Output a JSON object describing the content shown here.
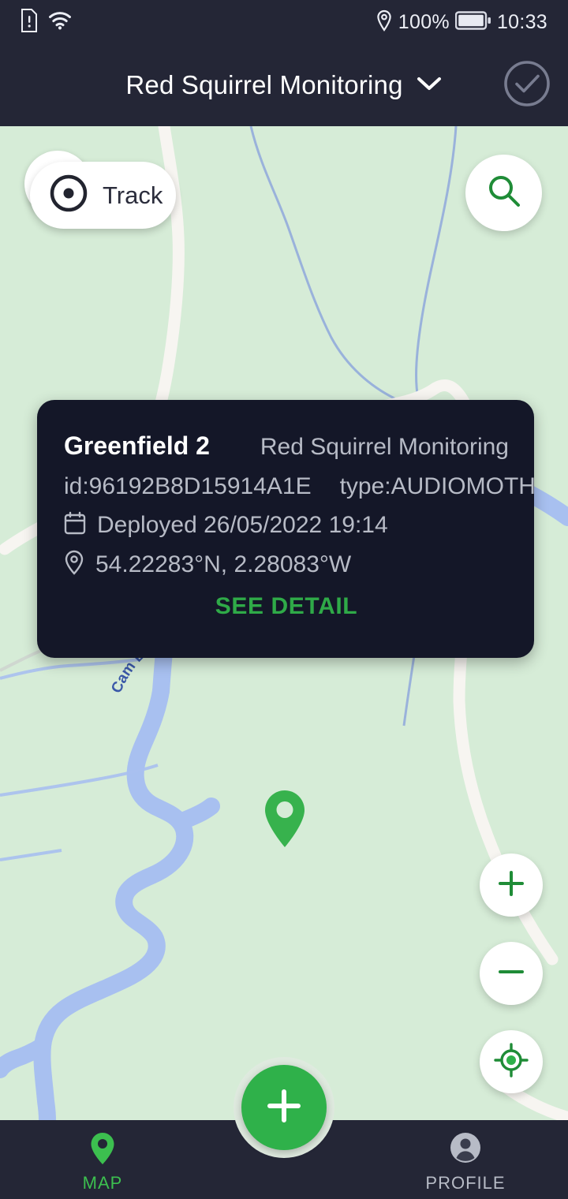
{
  "status_bar": {
    "sim_icon": "sim-alert-icon",
    "wifi_icon": "wifi-icon",
    "location_icon": "location-pin-icon",
    "battery_percent": "100%",
    "battery_icon": "battery-full-icon",
    "time": "10:33"
  },
  "app_bar": {
    "title": "Red Squirrel Monitoring",
    "dropdown_icon": "chevron-down-icon",
    "action_icon": "check-circle-icon"
  },
  "map": {
    "track_button": {
      "label": "Track",
      "icon": "record-circle-icon"
    },
    "search_button": {
      "icon": "search-icon"
    },
    "zoom_in_button": {
      "icon": "plus-icon",
      "label": "+"
    },
    "zoom_out_button": {
      "icon": "minus-icon",
      "label": "−"
    },
    "locate_button": {
      "icon": "my-location-icon"
    },
    "marker": {
      "icon": "map-pin-icon"
    },
    "labels": [
      {
        "text": "Cam Beck",
        "type": "river"
      }
    ]
  },
  "info_card": {
    "title": "Greenfield 2",
    "project": "Red Squirrel Monitoring",
    "id": "id:96192B8D15914A1E",
    "type": "type:AUDIOMOTH",
    "deployed": "Deployed 26/05/2022 19:14",
    "deployed_icon": "calendar-icon",
    "coordinates": "54.22283°N, 2.28083°W",
    "coordinates_icon": "location-pin-icon",
    "see_detail_label": "SEE DETAIL"
  },
  "bottom_nav": {
    "items": [
      {
        "label": "MAP",
        "icon": "map-pin-icon",
        "active": true
      },
      {
        "label": "PROFILE",
        "icon": "person-icon",
        "active": false
      }
    ],
    "fab": {
      "icon": "plus-icon"
    }
  },
  "colors": {
    "accent_green": "#2fb14a",
    "card_bg": "#141728",
    "chrome_bg": "#242636",
    "map_bg": "#d6ecd7",
    "water": "#a8c0f0",
    "road": "#f5f3ef",
    "muted_text": "#b7bbc6"
  }
}
